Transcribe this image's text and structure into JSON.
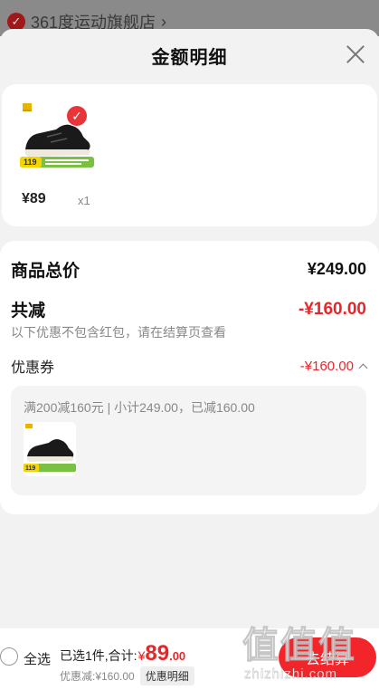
{
  "background_page": {
    "store_name": "361度运动旗舰店",
    "chevron": "›"
  },
  "sheet": {
    "title": "金额明细"
  },
  "product": {
    "price": "¥89",
    "quantity": "x1",
    "image_badge_number": "119",
    "image_badge_text": "券后"
  },
  "summary": {
    "total_label": "商品总价",
    "total_value": "¥249.00",
    "discount_label": "共减",
    "discount_value": "-¥160.00",
    "discount_note": "以下优惠不包含红包，请在结算页查看",
    "coupon_label": "优惠券",
    "coupon_value": "-¥160.00"
  },
  "coupon_detail": {
    "text": "满200减160元 | 小计249.00，已减160.00"
  },
  "bottom": {
    "select_all": "全选",
    "selected_text": "已选1件,合计:",
    "currency": "¥",
    "total_int": "89",
    "total_dec": ".00",
    "discount_text": "优惠减:¥160.00",
    "detail_tag": "优惠明细",
    "checkout": "去结算"
  },
  "watermark": {
    "glyphs": "值值值",
    "url": "zhizhizhi.com"
  },
  "colors": {
    "accent_red": "#e8262a",
    "button_red": "#f2252b",
    "logo_yellow": "#e8b400",
    "badge_green": "#7ac143"
  }
}
